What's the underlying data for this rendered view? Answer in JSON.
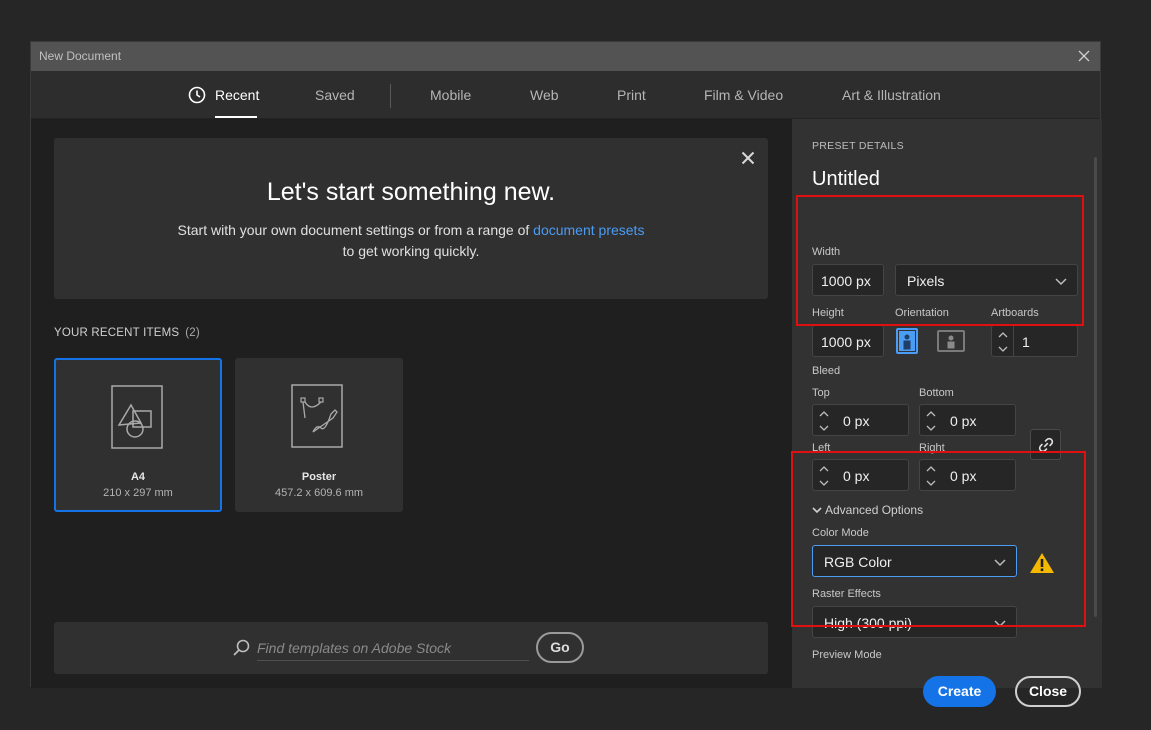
{
  "window": {
    "title": "New Document"
  },
  "tabs": [
    {
      "label": "Recent",
      "active": true
    },
    {
      "label": "Saved"
    },
    {
      "label": "Mobile"
    },
    {
      "label": "Web"
    },
    {
      "label": "Print"
    },
    {
      "label": "Film & Video"
    },
    {
      "label": "Art & Illustration"
    }
  ],
  "hero": {
    "title": "Let's start something new.",
    "sub_before": "Start with your own document settings or from a range of ",
    "sub_link": "document presets",
    "sub_after": "to get working quickly."
  },
  "recent": {
    "label": "YOUR RECENT ITEMS",
    "count": "(2)",
    "items": [
      {
        "name": "A4",
        "size": "210 x 297 mm",
        "selected": true
      },
      {
        "name": "Poster",
        "size": "457.2 x 609.6 mm"
      }
    ]
  },
  "search": {
    "placeholder": "Find templates on Adobe Stock",
    "go_label": "Go"
  },
  "preset": {
    "section_label": "PRESET DETAILS",
    "name": "Untitled",
    "width_label": "Width",
    "width_value": "1000 px",
    "units": "Pixels",
    "height_label": "Height",
    "height_value": "1000 px",
    "orientation_label": "Orientation",
    "artboards_label": "Artboards",
    "artboards_value": "1",
    "bleed_label": "Bleed",
    "top_label": "Top",
    "top_value": "0 px",
    "bottom_label": "Bottom",
    "bottom_value": "0 px",
    "left_label": "Left",
    "left_value": "0 px",
    "right_label": "Right",
    "right_value": "0 px",
    "advanced_label": "Advanced Options",
    "color_mode_label": "Color Mode",
    "color_mode_value": "RGB Color",
    "raster_label": "Raster Effects",
    "raster_value": "High (300 ppi)",
    "preview_label": "Preview Mode"
  },
  "actions": {
    "create": "Create",
    "close": "Close"
  },
  "colors": {
    "accent": "#1473e6",
    "link": "#4b9cf5",
    "warning": "#f5b800",
    "highlight": "#e01010"
  }
}
